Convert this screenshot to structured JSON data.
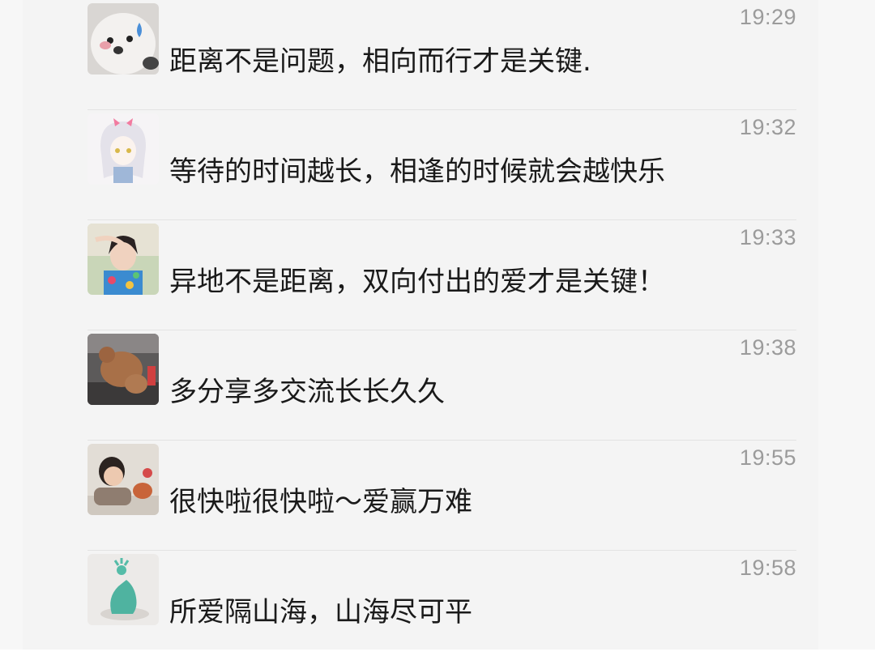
{
  "comments": [
    {
      "time": "19:29",
      "text": "距离不是问题，相向而行才是关键.",
      "avatar": "white-dog-avatar"
    },
    {
      "time": "19:32",
      "text": "等待的时间越长，相逢的时候就会越快乐",
      "avatar": "anime-girl-avatar"
    },
    {
      "time": "19:33",
      "text": "异地不是距离，双向付出的爱才是关键！",
      "avatar": "girl-photo-avatar"
    },
    {
      "time": "19:38",
      "text": "多分享多交流长长久久",
      "avatar": "teddy-bear-avatar"
    },
    {
      "time": "19:55",
      "text": "很快啦很快啦～爱赢万难",
      "avatar": "child-photo-avatar"
    },
    {
      "time": "19:58",
      "text": "所爱隔山海，山海尽可平",
      "avatar": "figurine-avatar"
    }
  ]
}
